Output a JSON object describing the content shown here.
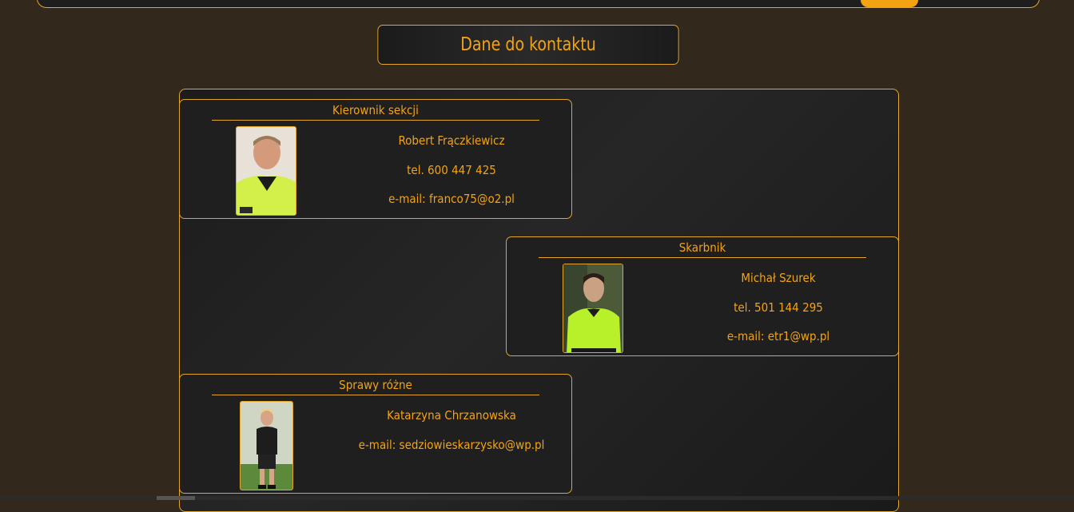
{
  "header": {
    "title": "Dane do kontaktu"
  },
  "contacts": [
    {
      "role": "Kierownik sekcji",
      "name": "Robert Frączkiewicz",
      "phone": "tel. 600 447 425",
      "email": "e-mail: franco75@o2.pl",
      "photo_icon": "person-photo-icon"
    },
    {
      "role": "Skarbnik",
      "name": "Michał Szurek",
      "phone": "tel. 501 144 295",
      "email": "e-mail: etr1@wp.pl",
      "photo_icon": "person-photo-icon"
    },
    {
      "role": "Sprawy różne",
      "name": "Katarzyna Chrzanowska",
      "email": "e-mail: sedziowieskarzysko@wp.pl",
      "photo_icon": "person-photo-icon"
    }
  ],
  "colors": {
    "accent": "#f3a312",
    "border": "#e3a52c",
    "page_bg": "#32281b",
    "panel_bg": "#1f1f1f"
  }
}
